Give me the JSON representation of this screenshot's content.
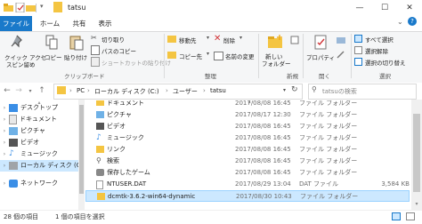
{
  "window": {
    "title": "tatsu",
    "controls": {
      "minimize": "—",
      "maximize": "☐",
      "close": "✕"
    }
  },
  "tabs": [
    {
      "label": "ファイル"
    },
    {
      "label": "ホーム"
    },
    {
      "label": "共有"
    },
    {
      "label": "表示"
    }
  ],
  "ribbon": {
    "clipboard": {
      "pin": "クイック アクセ\nスにピン留め",
      "pin_l1": "クイック アクセ",
      "pin_l2": "スピン留め",
      "copy": "コピー",
      "paste": "貼り付け",
      "cut": "切り取り",
      "copy_path": "パスのコピー",
      "paste_shortcut": "ショートカットの貼り付け",
      "group": "クリップボード"
    },
    "organize": {
      "move_to": "移動先",
      "copy_to": "コピー先",
      "delete": "削除",
      "rename": "名前の変更",
      "group": "整理"
    },
    "new": {
      "new_folder_l1": "新しい",
      "new_folder_l2": "フォルダー",
      "group": "新規"
    },
    "open": {
      "properties": "プロパティ",
      "group": "開く"
    },
    "select": {
      "select_all": "すべて選択",
      "select_none": "選択解除",
      "invert": "選択の切り替え",
      "group": "選択"
    }
  },
  "address": {
    "crumbs": [
      "PC",
      "ローカル ディスク (C:)",
      "ユーザー",
      "tatsu"
    ],
    "search_placeholder": "tatsuの検索"
  },
  "nav": {
    "items": [
      {
        "label": "デスクトップ",
        "icon": "desktop-icon"
      },
      {
        "label": "ドキュメント",
        "icon": "document-icon"
      },
      {
        "label": "ピクチャ",
        "icon": "picture-icon"
      },
      {
        "label": "ビデオ",
        "icon": "video-icon"
      },
      {
        "label": "ミュージック",
        "icon": "music-icon"
      },
      {
        "label": "ローカル ディスク (C:)",
        "icon": "drive-icon",
        "selected": true
      },
      {
        "label": "ネットワーク",
        "icon": "network-icon"
      }
    ]
  },
  "files": {
    "rows": [
      {
        "name": "ドキュメント",
        "date": "2017/08/08 16:45",
        "type": "ファイル フォルダー",
        "size": "",
        "icon": "document-folder-icon",
        "partial": true
      },
      {
        "name": "ピクチャ",
        "date": "2017/08/17 12:30",
        "type": "ファイル フォルダー",
        "size": "",
        "icon": "picture-folder-icon"
      },
      {
        "name": "ビデオ",
        "date": "2017/08/08 16:45",
        "type": "ファイル フォルダー",
        "size": "",
        "icon": "video-folder-icon"
      },
      {
        "name": "ミュージック",
        "date": "2017/08/08 16:45",
        "type": "ファイル フォルダー",
        "size": "",
        "icon": "music-folder-icon"
      },
      {
        "name": "リンク",
        "date": "2017/08/08 16:45",
        "type": "ファイル フォルダー",
        "size": "",
        "icon": "link-folder-icon"
      },
      {
        "name": "検索",
        "date": "2017/08/08 16:45",
        "type": "ファイル フォルダー",
        "size": "",
        "icon": "search-folder-icon"
      },
      {
        "name": "保存したゲーム",
        "date": "2017/08/08 16:45",
        "type": "ファイル フォルダー",
        "size": "",
        "icon": "game-folder-icon"
      },
      {
        "name": "NTUSER.DAT",
        "date": "2017/08/29 13:04",
        "type": "DAT ファイル",
        "size": "3,584 KB",
        "icon": "file-icon"
      },
      {
        "name": "dcmtk-3.6.2-win64-dynamic",
        "date": "2017/08/30 10:43",
        "type": "ファイル フォルダー",
        "size": "",
        "icon": "folder-icon",
        "selected": true
      }
    ]
  },
  "status": {
    "count": "28 個の項目",
    "selected": "1 個の項目を選択"
  },
  "colors": {
    "accent": "#1979ca",
    "folder": "#f4c542",
    "selected_row": "#cce8ff",
    "nav_selected": "#cce8ff"
  }
}
